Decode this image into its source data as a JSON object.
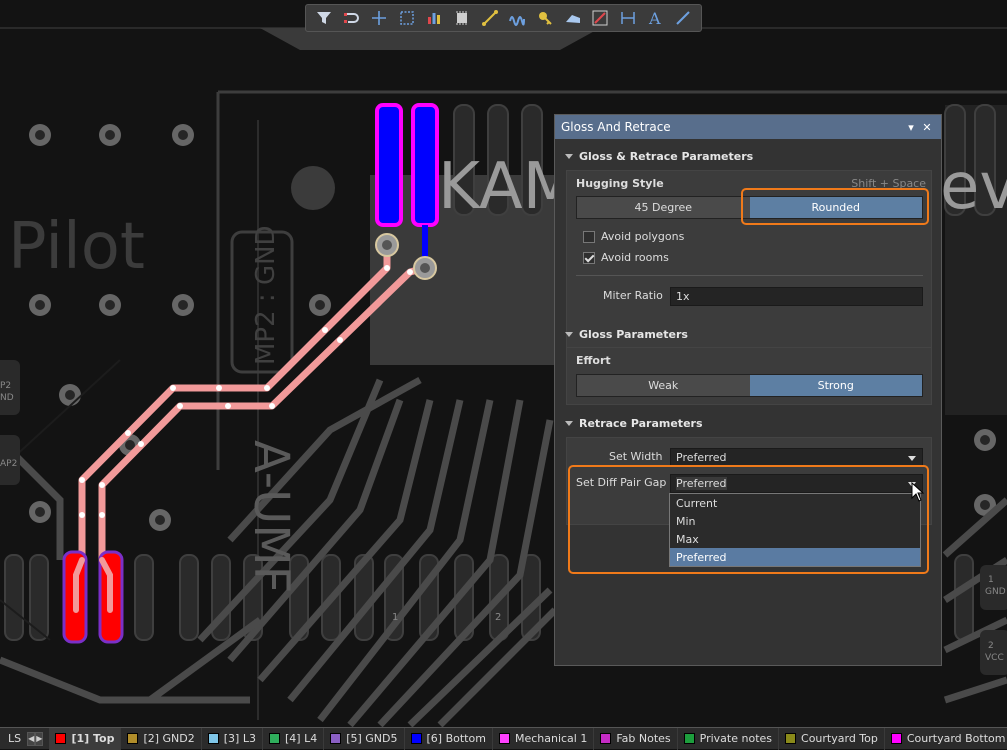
{
  "toolbar": {
    "tools": [
      "filter-icon",
      "interactive-routing-icon",
      "crosshair-icon",
      "select-rectangle-icon",
      "bar-chart-icon",
      "component-icon",
      "route-icon",
      "length-tuning-icon",
      "key-icon",
      "polygon-icon",
      "graphic-edit-icon",
      "dimension-icon",
      "text-icon",
      "line-icon"
    ]
  },
  "board_text": {
    "pilot": "Pilot",
    "kam": "KAM",
    "evo": "ev",
    "mp2_gnd": "MP2 : GND",
    "left1": "P2",
    "left1b": "ND",
    "left2": "AP2",
    "right_gnd": "GND",
    "right_1": "1",
    "right_2": "2",
    "right_vcc": "VCC",
    "vertical_text": "A-UMF",
    "pad1": "1",
    "pad2": "2"
  },
  "panel": {
    "title": "Gloss And Retrace",
    "pin": "▾",
    "close": "✕",
    "gloss_retrace": {
      "heading": "Gloss & Retrace Parameters",
      "hugging_label": "Hugging Style",
      "hugging_hint": "Shift + Space",
      "hugging_options": [
        "45 Degree",
        "Rounded"
      ],
      "hugging_selected": "Rounded",
      "avoid_polygons": "Avoid polygons",
      "avoid_polygons_checked": false,
      "avoid_rooms": "Avoid rooms",
      "avoid_rooms_checked": true,
      "miter_label": "Miter Ratio",
      "miter_value": "1x"
    },
    "gloss": {
      "heading": "Gloss Parameters",
      "effort_label": "Effort",
      "effort_options": [
        "Weak",
        "Strong"
      ],
      "effort_selected": "Strong"
    },
    "retrace": {
      "heading": "Retrace Parameters",
      "width_label": "Set Width",
      "width_value": "Preferred",
      "gap_label": "Set Diff Pair Gap",
      "gap_value": "Preferred",
      "gap_options": [
        "Current",
        "Min",
        "Max",
        "Preferred"
      ],
      "gap_selected": "Preferred"
    }
  },
  "layerbar": {
    "ls_label": "LS",
    "layers": [
      {
        "label": "[1] Top",
        "color": "#ff0000",
        "active": true
      },
      {
        "label": "[2] GND2",
        "color": "#b08d2a",
        "active": false
      },
      {
        "label": "[3] L3",
        "color": "#7fc6e8",
        "active": false
      },
      {
        "label": "[4] L4",
        "color": "#2fae5c",
        "active": false
      },
      {
        "label": "[5] GND5",
        "color": "#8a5fc4",
        "active": false
      },
      {
        "label": "[6] Bottom",
        "color": "#0000ff",
        "active": false
      },
      {
        "label": "Mechanical 1",
        "color": "#ff40ff",
        "active": false
      },
      {
        "label": "Fab Notes",
        "color": "#c52bc5",
        "active": false
      },
      {
        "label": "Private notes",
        "color": "#1d9e3d",
        "active": false
      },
      {
        "label": "Courtyard Top",
        "color": "#8a8a1a",
        "active": false
      },
      {
        "label": "Courtyard Bottom",
        "color": "#ff00ff",
        "active": false
      }
    ]
  },
  "colors": {
    "accent_orange": "#f07a1a",
    "panel_title_bg": "#586e8c",
    "selected_seg": "#5d7fa3",
    "top_layer": "#ff0000",
    "bottom_layer": "#0000ff",
    "highlight_trace": "#f29a9a"
  }
}
